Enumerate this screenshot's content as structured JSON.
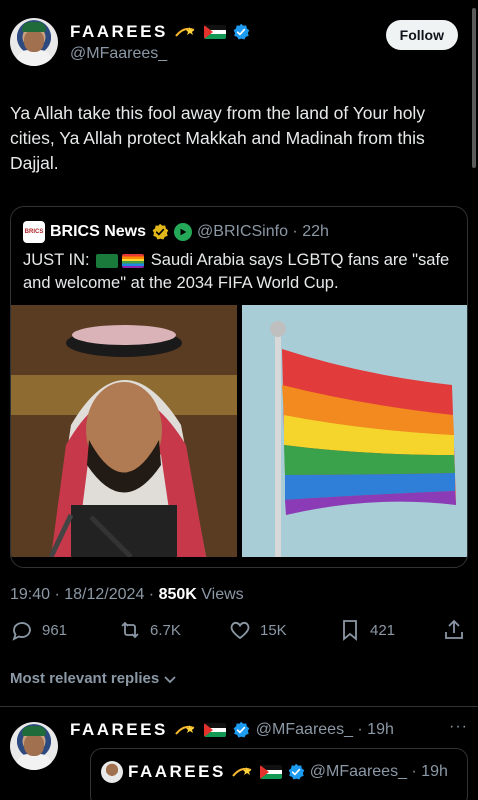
{
  "tweet": {
    "display_name": "FAAREES",
    "handle": "@MFaarees_",
    "follow_label": "Follow",
    "text": "Ya Allah take this fool away from the land of Your holy cities, Ya Allah protect Makkah and Madinah from this Dajjal.",
    "timestamp": "19:40 · 18/12/2024 · ",
    "views_count": "850K",
    "views_label": " Views",
    "replies": "961",
    "reposts": "6.7K",
    "likes": "15K",
    "bookmarks": "421"
  },
  "quote": {
    "logo_text": "BRICS",
    "name": "BRICS News",
    "handle_time": "@BRICSinfo · 22h",
    "text_prefix": "JUST IN: ",
    "text_main": " Saudi Arabia says LGBTQ fans are \"safe and welcome\" at the 2034 FIFA World Cup."
  },
  "replies_section": {
    "sort_label": "Most relevant replies"
  },
  "reply": {
    "display_name": "FAAREES",
    "handle_time": "@MFaarees_ · 19h",
    "more": "···",
    "inner_name": "FAAREES",
    "inner_handle_time": "@MFaarees_ · 19h"
  },
  "colors": {
    "background": "#000000",
    "text": "#e7e9ea",
    "muted": "#8b98a5",
    "verified": "#1d9bf0",
    "border": "#2f3336"
  }
}
